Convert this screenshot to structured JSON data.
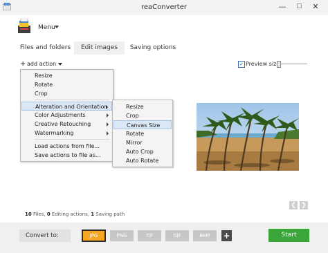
{
  "window": {
    "title": "reaConverter",
    "minimize_glyph": "—",
    "maximize_glyph": "☐",
    "close_glyph": "✕"
  },
  "menu": {
    "label": "Menu"
  },
  "tabs": [
    {
      "label": "Files and folders",
      "active": false
    },
    {
      "label": "Edit images",
      "active": true
    },
    {
      "label": "Saving options",
      "active": false
    }
  ],
  "toolbar": {
    "add_action_label": "add action",
    "add_action_glyph": "+",
    "preview_checked": true,
    "preview_check_glyph": "✓",
    "preview_label": "Preview size:"
  },
  "action_menu": {
    "items": [
      {
        "label": "Resize"
      },
      {
        "label": "Rotate"
      },
      {
        "label": "Crop"
      },
      {
        "label": "Alteration and Orientation",
        "submenu": true,
        "highlighted": true
      },
      {
        "label": "Color Adjustments",
        "submenu": true
      },
      {
        "label": "Creative Retouching",
        "submenu": true
      },
      {
        "label": "Watermarking",
        "submenu": true
      },
      {
        "label": "Load actions from file..."
      },
      {
        "label": "Save actions to file as..."
      }
    ]
  },
  "submenu": {
    "items": [
      {
        "label": "Resize"
      },
      {
        "label": "Crop"
      },
      {
        "label": "Canvas Size",
        "highlighted": true
      },
      {
        "label": "Rotate"
      },
      {
        "label": "Mirror"
      },
      {
        "label": "Auto Crop"
      },
      {
        "label": "Auto Rotate"
      }
    ]
  },
  "stats": {
    "files_count": "10",
    "files_label": "Files,",
    "editing_count": "0",
    "editing_label": "Editing actions,",
    "saving_count": "1",
    "saving_label": "Saving path"
  },
  "nav": {
    "prev_glyph": "❮",
    "next_glyph": "❯"
  },
  "footer": {
    "convert_label": "Convert to:",
    "formats": [
      {
        "label": "JPG",
        "selected": true
      },
      {
        "label": "PNG",
        "selected": false
      },
      {
        "label": "TIF",
        "selected": false
      },
      {
        "label": "GIF",
        "selected": false
      },
      {
        "label": "BMP",
        "selected": false
      }
    ],
    "add_format_glyph": "+",
    "start_label": "Start"
  },
  "colors": {
    "accent_selected_format": "#f5a623",
    "start_button": "#3aa63a",
    "menu_highlight": "#dbe7f5"
  }
}
